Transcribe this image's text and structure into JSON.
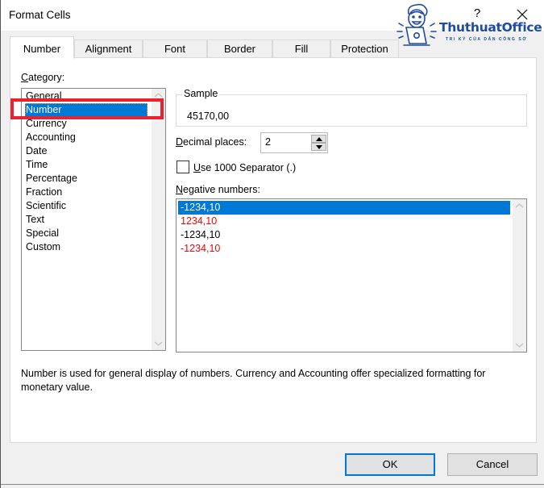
{
  "window": {
    "title": "Format Cells",
    "help_label": "?",
    "close_icon": "close-x-icon"
  },
  "watermark": {
    "brand": "ThuthuatOffice",
    "tagline": "TRI KỶ CỦA DÂN CÔNG SỞ",
    "color": "#1e4aa3"
  },
  "tabs": [
    {
      "label": "Number",
      "active": true
    },
    {
      "label": "Alignment",
      "active": false
    },
    {
      "label": "Font",
      "active": false
    },
    {
      "label": "Border",
      "active": false
    },
    {
      "label": "Fill",
      "active": false
    },
    {
      "label": "Protection",
      "active": false
    }
  ],
  "category": {
    "label_prefix": "",
    "label_accel": "C",
    "label_rest": "ategory:",
    "items": [
      "General",
      "Number",
      "Currency",
      "Accounting",
      "Date",
      "Time",
      "Percentage",
      "Fraction",
      "Scientific",
      "Text",
      "Special",
      "Custom"
    ],
    "selected": "Number"
  },
  "sample": {
    "legend": "Sample",
    "value": "45170,00"
  },
  "decimal_places": {
    "label_accel": "D",
    "label_rest": "ecimal places:",
    "value": "2"
  },
  "separator": {
    "label_accel": "U",
    "label_rest": "se 1000 Separator (.)",
    "checked": false
  },
  "negative_numbers": {
    "label_accel": "N",
    "label_rest": "egative numbers:",
    "items": [
      {
        "text": "-1234,10",
        "color": "#000000",
        "selected": true
      },
      {
        "text": "1234,10",
        "color": "#ff0000",
        "selected": false
      },
      {
        "text": "-1234,10",
        "color": "#000000",
        "selected": false
      },
      {
        "text": "-1234,10",
        "color": "#ff0000",
        "selected": false
      }
    ]
  },
  "description": "Number is used for general display of numbers.  Currency and Accounting offer specialized formatting for monetary value.",
  "buttons": {
    "ok": "OK",
    "cancel": "Cancel"
  },
  "colors": {
    "selection": "#0078d7",
    "highlight_annotation": "#e8222e",
    "negative_red": "#ff0000"
  }
}
